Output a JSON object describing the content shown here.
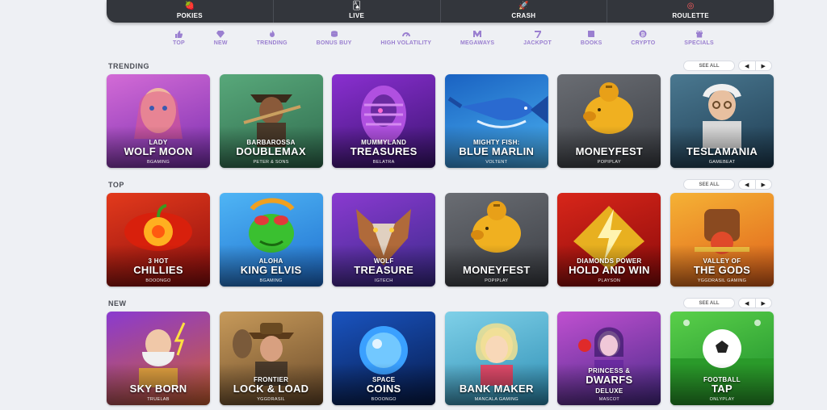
{
  "topbar": [
    {
      "label": "POKIES",
      "icon": "strawberry-icon",
      "glyph": "🍓",
      "color": "#ff5d5d"
    },
    {
      "label": "LIVE",
      "icon": "playing-card-icon",
      "glyph": "🂡",
      "color": "#ffffff"
    },
    {
      "label": "CRASH",
      "icon": "rocket-icon",
      "glyph": "🚀",
      "color": "#ff7a5c"
    },
    {
      "label": "ROULETTE",
      "icon": "roulette-wheel-icon",
      "glyph": "◎",
      "color": "#ff5d5d"
    }
  ],
  "filters": [
    {
      "label": "TOP",
      "icon": "thumbs-up-icon"
    },
    {
      "label": "NEW",
      "icon": "diamond-icon"
    },
    {
      "label": "TRENDING",
      "icon": "flame-icon"
    },
    {
      "label": "BONUS BUY",
      "icon": "coins-icon"
    },
    {
      "label": "HIGH VOLATILITY",
      "icon": "gauge-icon"
    },
    {
      "label": "MEGAWAYS",
      "icon": "megaways-m-icon"
    },
    {
      "label": "JACKPOT",
      "icon": "seven-icon"
    },
    {
      "label": "BOOKS",
      "icon": "book-icon"
    },
    {
      "label": "CRYPTO",
      "icon": "bitcoin-icon"
    },
    {
      "label": "SPECIALS",
      "icon": "gift-icon"
    }
  ],
  "accent": "#9a7fd0",
  "see_all_label": "SEE ALL",
  "sections": [
    {
      "title": "TRENDING",
      "games": [
        {
          "line1": "LADY",
          "line2": "WOLF MOON",
          "provider": "BGAMING",
          "bg": [
            "#7a2fb0",
            "#d36bd6"
          ],
          "motif": "face"
        },
        {
          "line1": "BARBAROSSA",
          "line2": "DOUBLEMAX",
          "provider": "PETER & SONS",
          "bg": [
            "#2f6b4e",
            "#58a87a"
          ],
          "motif": "pirate"
        },
        {
          "line1": "MUMMYLAND",
          "line2": "TREASURES",
          "provider": "BELATRA",
          "bg": [
            "#3a1470",
            "#8a2fd0"
          ],
          "motif": "mummy"
        },
        {
          "line1": "MIGHTY FISH:",
          "line2": "BLUE MARLIN",
          "provider": "VOLTENT",
          "bg": [
            "#4ab2f0",
            "#1a62c2"
          ],
          "motif": "fish"
        },
        {
          "line1": "",
          "line2": "MONEYFEST",
          "provider": "POPIPLAY",
          "bg": [
            "#3b3e44",
            "#6a6d73"
          ],
          "motif": "pig"
        },
        {
          "line1": "",
          "line2": "TESLAMANIA",
          "provider": "GAMEBEAT",
          "bg": [
            "#1e3c52",
            "#4a7890"
          ],
          "motif": "scientist"
        }
      ]
    },
    {
      "title": "TOP",
      "games": [
        {
          "line1": "3 HOT",
          "line2": "CHILLIES",
          "provider": "BOOONGO",
          "bg": [
            "#8c0d0d",
            "#e33a1c"
          ],
          "motif": "chili"
        },
        {
          "line1": "ALOHA",
          "line2": "KING ELVIS",
          "provider": "BGAMING",
          "bg": [
            "#1f6fcf",
            "#4fb5f5"
          ],
          "motif": "frog"
        },
        {
          "line1": "WOLF",
          "line2": "TREASURE",
          "provider": "IGTECH",
          "bg": [
            "#3a2a8a",
            "#8a3ad0"
          ],
          "motif": "wolf"
        },
        {
          "line1": "",
          "line2": "MONEYFEST",
          "provider": "POPIPLAY",
          "bg": [
            "#3b3e44",
            "#6a6d73"
          ],
          "motif": "pig"
        },
        {
          "line1": "DIAMONDS POWER",
          "line2": "HOLD AND WIN",
          "provider": "PLAYSON",
          "bg": [
            "#8a0a0a",
            "#d8261a"
          ],
          "motif": "bolt"
        },
        {
          "line1": "VALLEY OF",
          "line2": "THE GODS",
          "provider": "YGGDRASIL GAMING",
          "bg": [
            "#e0601a",
            "#f5b235"
          ],
          "motif": "god"
        }
      ]
    },
    {
      "title": "NEW",
      "games": [
        {
          "line1": "",
          "line2": "SKY BORN",
          "provider": "TRUELAB",
          "bg": [
            "#d06030",
            "#8a3ad0"
          ],
          "motif": "zeus"
        },
        {
          "line1": "FRONTIER",
          "line2": "LOCK & LOAD",
          "provider": "YGGDRASIL",
          "bg": [
            "#6a4a2a",
            "#c79a5a"
          ],
          "motif": "cowboy"
        },
        {
          "line1": "SPACE",
          "line2": "COINS",
          "provider": "BOOONGO",
          "bg": [
            "#061a4a",
            "#1a54c0"
          ],
          "motif": "orb"
        },
        {
          "line1": "",
          "line2": "BANK MAKER",
          "provider": "MANCALA GAMING",
          "bg": [
            "#2e8fb5",
            "#7fd0e8"
          ],
          "motif": "lady"
        },
        {
          "line1": "PRINCESS &",
          "line2": "DWARFS",
          "provider": "MASCOT",
          "bg": [
            "#4a2a8a",
            "#c050d0"
          ],
          "motif": "princess",
          "line3": "DELUXE"
        },
        {
          "line1": "FOOTBALL",
          "line2": "TAP",
          "provider": "ONLYPLAY",
          "bg": [
            "#1a8a2a",
            "#5ad04a"
          ],
          "motif": "ball"
        }
      ]
    }
  ]
}
